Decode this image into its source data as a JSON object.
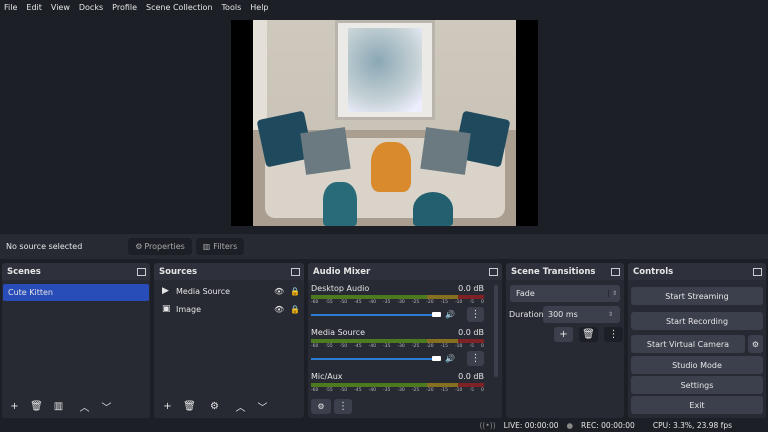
{
  "menu": [
    "File",
    "Edit",
    "View",
    "Docks",
    "Profile",
    "Scene Collection",
    "Tools",
    "Help"
  ],
  "source_bar": {
    "status": "No source selected",
    "properties": "Properties",
    "filters": "Filters"
  },
  "scenes": {
    "title": "Scenes",
    "items": [
      "Cute Kitten"
    ]
  },
  "sources": {
    "title": "Sources",
    "items": [
      {
        "name": "Media Source",
        "icon": "play-icon"
      },
      {
        "name": "Image",
        "icon": "image-icon"
      }
    ]
  },
  "audio": {
    "title": "Audio Mixer",
    "ticks": [
      "-60",
      "-55",
      "-50",
      "-45",
      "-40",
      "-35",
      "-30",
      "-25",
      "-20",
      "-15",
      "-10",
      "-5",
      "0"
    ],
    "channels": [
      {
        "name": "Desktop Audio",
        "db": "0.0 dB",
        "volume": 100
      },
      {
        "name": "Media Source",
        "db": "0.0 dB",
        "volume": 100
      },
      {
        "name": "Mic/Aux",
        "db": "0.0 dB"
      }
    ]
  },
  "transitions": {
    "title": "Scene Transitions",
    "selected": "Fade",
    "duration_label": "Duration",
    "duration": "300 ms"
  },
  "controls": {
    "title": "Controls",
    "start_streaming": "Start Streaming",
    "start_recording": "Start Recording",
    "start_virtual_camera": "Start Virtual Camera",
    "studio_mode": "Studio Mode",
    "settings": "Settings",
    "exit": "Exit"
  },
  "status": {
    "live": "LIVE: 00:00:00",
    "rec": "REC: 00:00:00",
    "cpu": "CPU: 3.3%, 23.98 fps"
  },
  "colors": {
    "selected": "#284cb8",
    "slider": "#2b7bd6"
  }
}
